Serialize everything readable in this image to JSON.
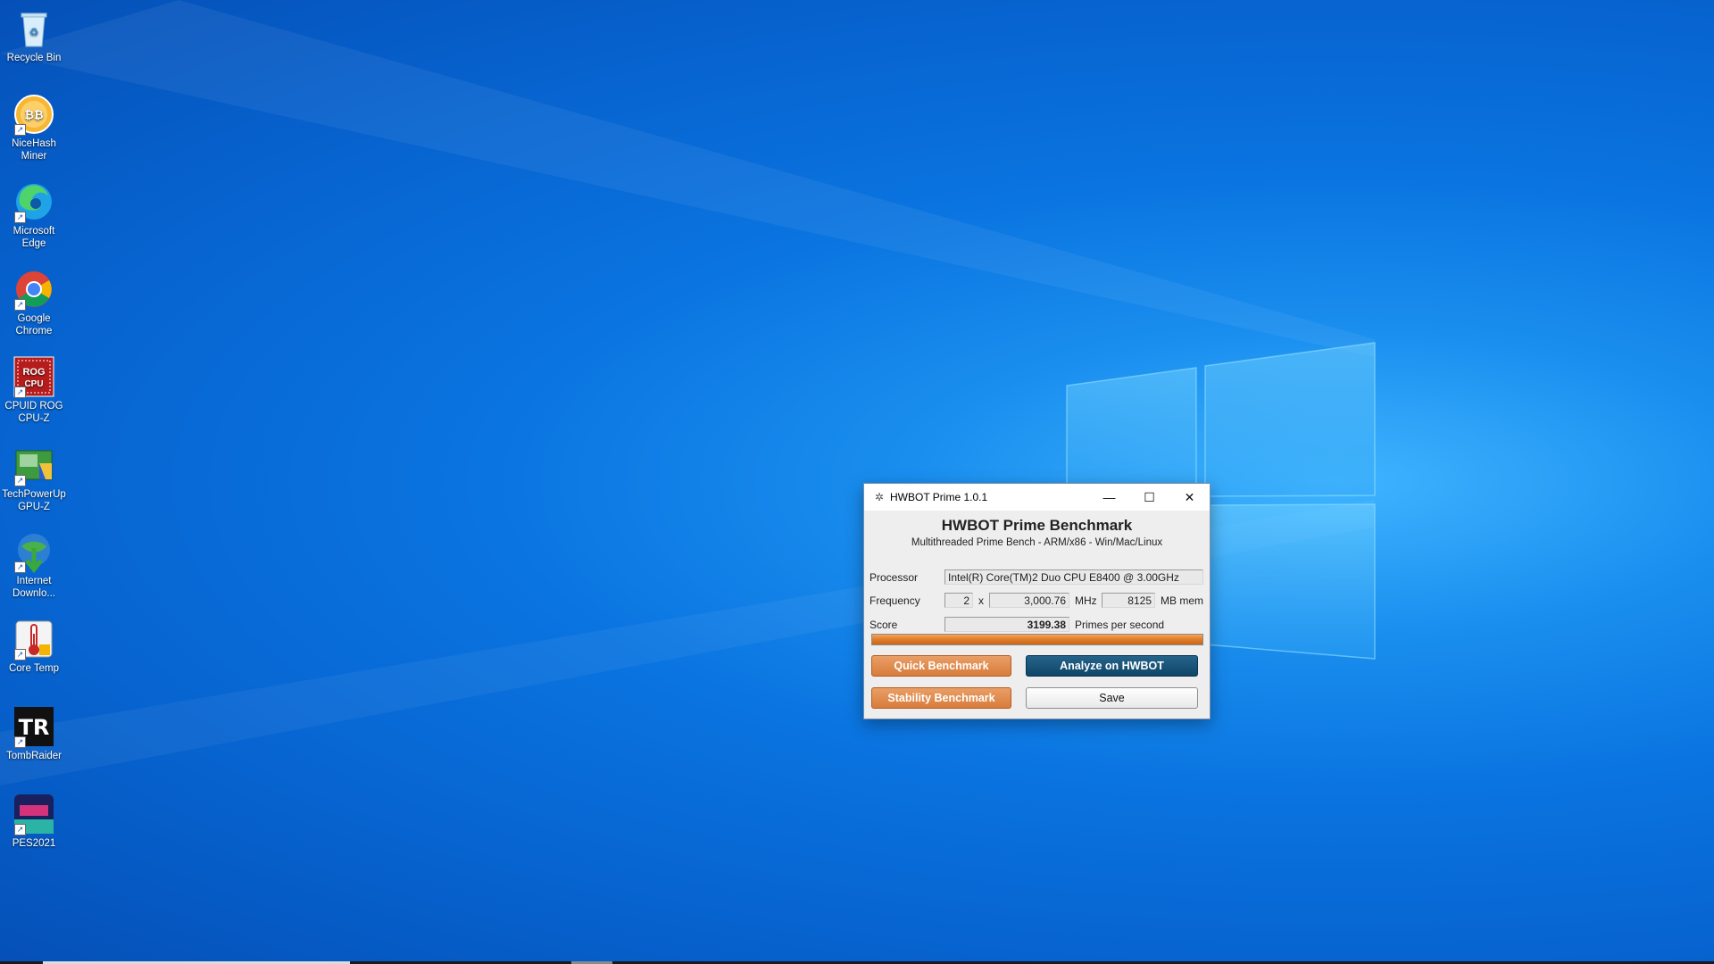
{
  "desktop": {
    "icons": [
      {
        "label": "Recycle Bin",
        "icon": "recycle-bin-icon"
      },
      {
        "label": "NiceHash Miner",
        "icon": "nicehash-icon"
      },
      {
        "label": "Microsoft Edge",
        "icon": "edge-icon"
      },
      {
        "label": "Google Chrome",
        "icon": "chrome-icon"
      },
      {
        "label": "CPUID ROG CPU-Z",
        "icon": "cpuz-icon"
      },
      {
        "label": "TechPowerUp GPU-Z",
        "icon": "gpuz-icon"
      },
      {
        "label": "Internet Downlo...",
        "icon": "idm-icon"
      },
      {
        "label": "Core Temp",
        "icon": "coretemp-icon"
      },
      {
        "label": "TombRaider",
        "icon": "tombraider-icon"
      },
      {
        "label": "PES2021",
        "icon": "pes2021-icon"
      }
    ]
  },
  "window": {
    "title": "HWBOT Prime 1.0.1",
    "heading": "HWBOT Prime Benchmark",
    "subheading": "Multithreaded Prime Bench - ARM/x86 - Win/Mac/Linux",
    "processor_label": "Processor",
    "processor_value": "Intel(R) Core(TM)2 Duo CPU     E8400  @ 3.00GHz",
    "frequency_label": "Frequency",
    "cores": "2",
    "x_sep": "x",
    "frequency_value": "3,000.76",
    "mhz_label": "MHz",
    "memory_value": "8125",
    "mem_label": "MB mem",
    "score_label": "Score",
    "score_value": "3199.38",
    "score_unit": "Primes per second",
    "progress": 1.0,
    "buttons": {
      "quick": "Quick Benchmark",
      "analyze": "Analyze on HWBOT",
      "stability": "Stability Benchmark",
      "save": "Save"
    }
  },
  "colors": {
    "accent_orange": "#d87c3c",
    "accent_teal": "#0f4668"
  }
}
